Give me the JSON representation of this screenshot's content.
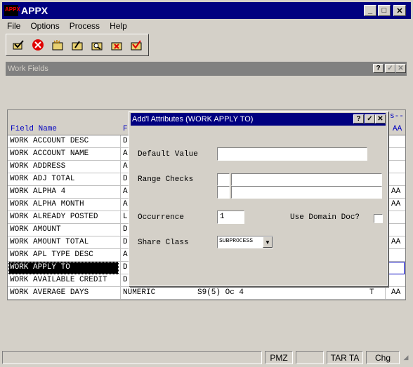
{
  "window": {
    "title": "APPX",
    "logo_text": "APPX"
  },
  "menu": [
    {
      "label": "File",
      "underline": "F"
    },
    {
      "label": "Options",
      "underline": "O"
    },
    {
      "label": "Process",
      "underline": "P"
    },
    {
      "label": "Help",
      "underline": "H"
    }
  ],
  "work_fields": {
    "title": "Work Fields",
    "header": {
      "field_name": "Field Name",
      "type_initial": "F",
      "right_frag": "s--",
      "right_col": "AA"
    },
    "rows": [
      {
        "name": "WORK ACCOUNT DESC",
        "type": "D",
        "aa": ""
      },
      {
        "name": "WORK ACCOUNT NAME",
        "type": "A",
        "aa": ""
      },
      {
        "name": "WORK ADDRESS",
        "type": "A",
        "aa": ""
      },
      {
        "name": "WORK ADJ TOTAL",
        "type": "D",
        "aa": ""
      },
      {
        "name": "WORK ALPHA 4",
        "type": "A",
        "aa": "AA"
      },
      {
        "name": "WORK ALPHA MONTH",
        "type": "A",
        "aa": "AA"
      },
      {
        "name": "WORK ALREADY POSTED",
        "type": "L",
        "aa": ""
      },
      {
        "name": "WORK AMOUNT",
        "type": "D",
        "aa": ""
      },
      {
        "name": "WORK AMOUNT TOTAL",
        "type": "D",
        "aa": "AA"
      },
      {
        "name": "WORK APL TYPE DESC",
        "type": "A",
        "aa": ""
      },
      {
        "name": "WORK APPLY TO",
        "type": "D",
        "aa": ""
      },
      {
        "name": "WORK AVAILABLE CREDIT",
        "type": "D",
        "aa": ""
      },
      {
        "name": "WORK AVERAGE DAYS",
        "type": "NUMERIC",
        "format": "S9(5) Oc 4",
        "t": "T",
        "aa": "AA"
      }
    ]
  },
  "dialog": {
    "title": "Add'l Attributes (WORK APPLY TO)",
    "default_value_label": "Default Value",
    "default_value": "",
    "range_checks_label": "Range Checks",
    "occurrence_label": "Occurrence",
    "occurrence_value": "1",
    "use_domain_doc_label": "Use Domain Doc?",
    "share_class_label": "Share Class",
    "share_class_value": "SUBPROCESS"
  },
  "status": {
    "pane1": "PMZ",
    "pane2": "TAR TA",
    "pane3": "Chg"
  }
}
